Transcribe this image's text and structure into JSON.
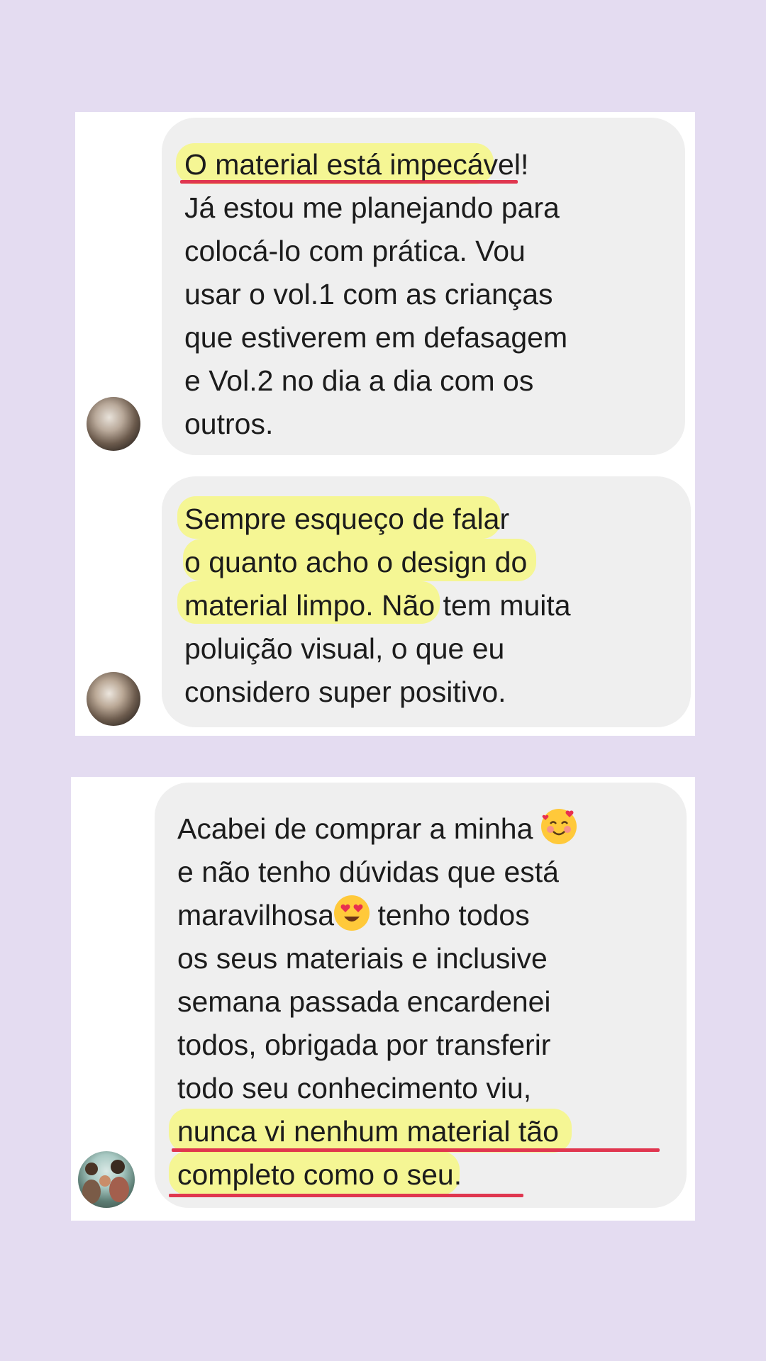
{
  "chat_screenshot_1": {
    "message_1": {
      "lines": [
        "O material está impecável!",
        "Já estou me planejando para",
        "colocá-lo com prática. Vou",
        "usar o vol.1 com as crianças",
        "que estiverem em defasagem",
        "e Vol.2 no dia a dia com os",
        "outros."
      ]
    },
    "message_2": {
      "lines": [
        "Sempre esqueço de falar",
        "o quanto acho o design do",
        "material limpo. Não tem muita",
        "poluição visual, o que eu",
        "considero super positivo."
      ]
    }
  },
  "chat_screenshot_2": {
    "message_3": {
      "line_1": "Acabei de comprar a minha",
      "line_2": "e não tenho dúvidas que está",
      "line_3": "maravilhosa",
      "line_3b": " tenho todos",
      "line_4": "os seus materiais e inclusive",
      "line_5": "semana passada encardenei",
      "line_6": "todos, obrigada por transferir",
      "line_7": "todo seu conhecimento viu,",
      "line_8": "nunca vi nenhum material tão",
      "line_9": "completo como o seu."
    },
    "emojis": [
      "smiling-face-with-hearts",
      "heart-eyes"
    ]
  },
  "colors": {
    "page_background": "#e4dcf1",
    "bubble": "#efefef",
    "highlight": "#f6f870",
    "underline": "#e0364f"
  }
}
